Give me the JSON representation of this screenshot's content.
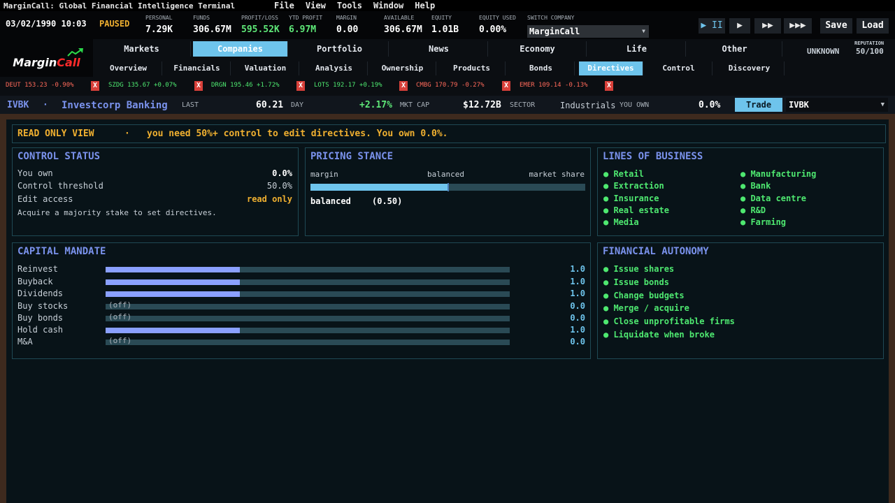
{
  "window": {
    "title": "MarginCall: Global Financial Intelligence Terminal",
    "menu": [
      "File",
      "View",
      "Tools",
      "Window",
      "Help"
    ]
  },
  "status": {
    "datetime": "03/02/1990 10:03",
    "state": "PAUSED",
    "personal": {
      "label": "PERSONAL",
      "value": "7.29K"
    },
    "funds": {
      "label": "FUNDS",
      "value": "306.67M"
    },
    "profit_loss": {
      "label": "PROFIT/LOSS",
      "value": "595.52K"
    },
    "ytd_profit": {
      "label": "YTD PROFIT",
      "value": "6.97M"
    },
    "margin": {
      "label": "MARGIN",
      "value": "0.00"
    },
    "available": {
      "label": "AVAILABLE",
      "value": "306.67M"
    },
    "equity": {
      "label": "EQUITY",
      "value": "1.01B"
    },
    "equity_used": {
      "label": "EQUITY USED",
      "value": "0.00%"
    },
    "switch_company": {
      "label": "SWITCH COMPANY",
      "value": "MarginCall"
    },
    "speed_buttons": [
      "▶ II",
      "▶",
      "▶▶",
      "▶▶▶"
    ],
    "save_label": "Save",
    "load_label": "Load"
  },
  "logo": {
    "part1": "Margin",
    "part2": "Call"
  },
  "nav": {
    "main_tabs": [
      "Markets",
      "Companies",
      "Portfolio",
      "News",
      "Economy",
      "Life",
      "Other"
    ],
    "main_active": "Companies",
    "sub_tabs": [
      "Overview",
      "Financials",
      "Valuation",
      "Analysis",
      "Ownership",
      "Products",
      "Bonds",
      "Directives",
      "Control",
      "Discovery"
    ],
    "sub_active": "Directives",
    "unknown": "UNKNOWN",
    "reputation_label": "REPUTATION",
    "reputation_value": "50/100"
  },
  "watchlist": [
    {
      "text": "DEUT 153.23 -0.90%",
      "up": false
    },
    {
      "text": "SZDG 135.67 +0.07%",
      "up": true
    },
    {
      "text": "DRGN 195.46 +1.72%",
      "up": true
    },
    {
      "text": "LOTS 192.17 +0.19%",
      "up": true
    },
    {
      "text": "CMBG 170.79 -0.27%",
      "up": false
    },
    {
      "text": "EMER 109.14 -0.13%",
      "up": false
    }
  ],
  "ticker": {
    "symbol": "IVBK",
    "separator": "·",
    "name": "Investcorp Banking",
    "last_label": "LAST",
    "last_value": "60.21",
    "day_label": "DAY",
    "day_value": "+2.17%",
    "mktcap_label": "MKT CAP",
    "mktcap_value": "$12.72B",
    "sector_label": "SECTOR",
    "sector_value": "Industrials",
    "own_label": "YOU OWN",
    "own_value": "0.0%",
    "trade_label": "Trade",
    "select_value": "IVBK"
  },
  "readonly": {
    "title": "READ ONLY VIEW",
    "separator": "·",
    "message": "you need 50%+ control to edit directives. You own 0.0%."
  },
  "control_status": {
    "title": "CONTROL STATUS",
    "rows": [
      {
        "key": "You own",
        "value": "0.0%"
      },
      {
        "key": "Control threshold",
        "value": "50.0%"
      },
      {
        "key": "Edit access",
        "value": "read only"
      }
    ],
    "note": "Acquire a majority stake to set directives."
  },
  "pricing_stance": {
    "title": "PRICING STANCE",
    "left_label": "margin",
    "mid_label": "balanced",
    "right_label": "market share",
    "value_text": "balanced",
    "value_num": "(0.50)",
    "position": 0.5
  },
  "lines_of_business": {
    "title": "LINES OF BUSINESS",
    "items": [
      "Retail",
      "Manufacturing",
      "Extraction",
      "Bank",
      "Insurance",
      "Data centre",
      "Real estate",
      "R&D",
      "Media",
      "Farming"
    ]
  },
  "capital_mandate": {
    "title": "CAPITAL MANDATE",
    "off_label": "(off)",
    "rows": [
      {
        "key": "Reinvest",
        "value": "1.0",
        "fill": 0.333,
        "off": false
      },
      {
        "key": "Buyback",
        "value": "1.0",
        "fill": 0.333,
        "off": false
      },
      {
        "key": "Dividends",
        "value": "1.0",
        "fill": 0.333,
        "off": false
      },
      {
        "key": "Buy stocks",
        "value": "0.0",
        "fill": 0,
        "off": true
      },
      {
        "key": "Buy bonds",
        "value": "0.0",
        "fill": 0,
        "off": true
      },
      {
        "key": "Hold cash",
        "value": "1.0",
        "fill": 0.333,
        "off": false
      },
      {
        "key": "M&A",
        "value": "0.0",
        "fill": 0,
        "off": true
      }
    ]
  },
  "financial_autonomy": {
    "title": "FINANCIAL AUTONOMY",
    "items": [
      "Issue shares",
      "Issue bonds",
      "Change budgets",
      "Merge / acquire",
      "Close unprofitable firms",
      "Liquidate when broke"
    ]
  },
  "colors": {
    "accent": "#6ec4ec",
    "title_blue": "#7a92ec",
    "green": "#4ee870",
    "amber": "#f0b030",
    "red": "#d8403a",
    "bar_fill": "#8aa0ff",
    "bar_track": "#2a4a55"
  }
}
